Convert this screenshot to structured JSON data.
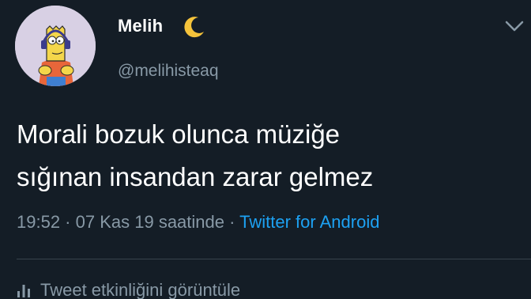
{
  "author": {
    "display_name": "Melih",
    "name_emoji_icon": "crescent-moon-icon",
    "handle": "@melihisteaq",
    "avatar_icon": "cartoon-character-avatar"
  },
  "tweet": {
    "line1": "Morali bozuk olunca müziğe",
    "line2": "sığınan insandan zarar gelmez"
  },
  "meta": {
    "time": "19:52",
    "sep1": " · ",
    "date": "07 Kas 19 saatinde",
    "sep2": " · ",
    "source": "Twitter for Android"
  },
  "actions": {
    "analytics_icon": "bar-chart-icon",
    "analytics_label": "Tweet etkinliğini görüntüle",
    "menu_icon": "chevron-down-icon"
  },
  "colors": {
    "background": "#141d26",
    "text": "#ffffff",
    "secondary": "#8899a6",
    "link": "#1da1f2",
    "divider": "#38444d",
    "moon": "#f5c33b"
  }
}
